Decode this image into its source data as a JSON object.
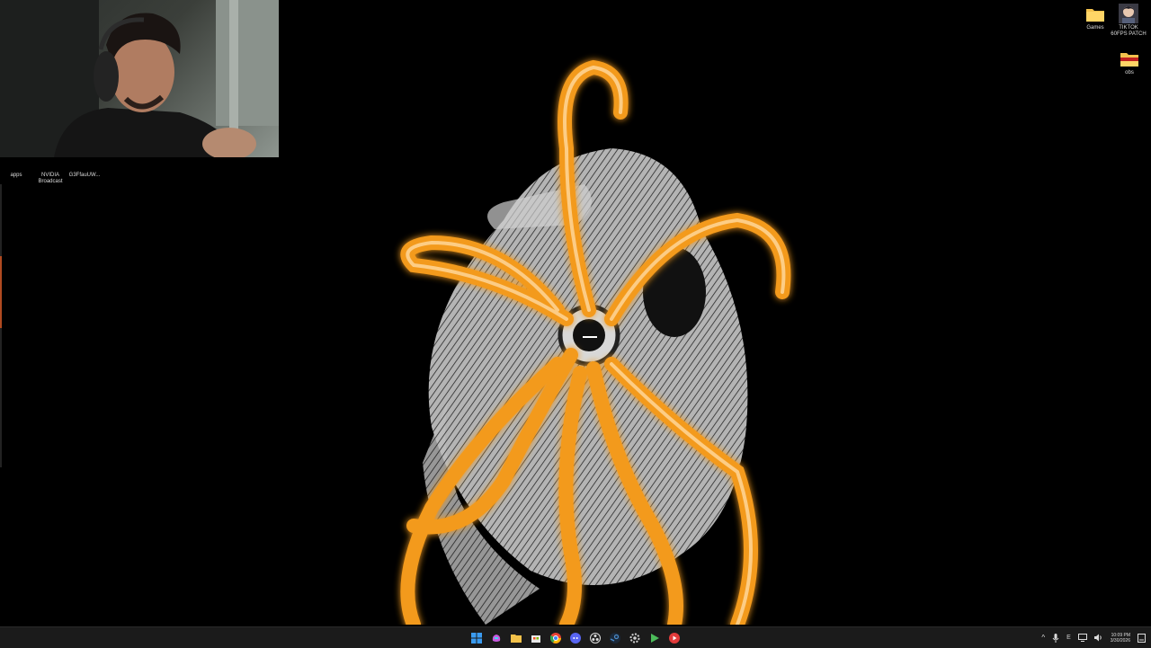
{
  "desktop": {
    "left_icons": [
      {
        "label": "apps",
        "icon": "app-shortcut-icon"
      },
      {
        "label": "NVIDIA\nBroadcast",
        "icon": "nvidia-broadcast-icon"
      },
      {
        "label": "G3FfauUW...",
        "icon": "file-shortcut-icon"
      }
    ],
    "right_icons": [
      {
        "label": "Games",
        "icon": "folder-icon"
      },
      {
        "label": "TIKTOK\n60FPS PATCH",
        "icon": "avatar-shortcut-icon"
      },
      {
        "label": "obs",
        "icon": "obs-folder-icon"
      }
    ]
  },
  "taskbar": {
    "apps": [
      {
        "name": "start",
        "icon": "windows-start-icon",
        "color": "#3a9bf0"
      },
      {
        "name": "copilot",
        "icon": "copilot-icon",
        "color": "#c95be0"
      },
      {
        "name": "file-explorer",
        "icon": "folder-icon",
        "color": "#f2c14a"
      },
      {
        "name": "store",
        "icon": "store-icon",
        "color": "#e8e8e8"
      },
      {
        "name": "chrome",
        "icon": "chrome-icon",
        "color": "#e94335"
      },
      {
        "name": "discord",
        "icon": "discord-icon",
        "color": "#5865f2"
      },
      {
        "name": "obs",
        "icon": "obs-icon",
        "color": "#dddddd"
      },
      {
        "name": "steam",
        "icon": "steam-icon",
        "color": "#4a8bc9"
      },
      {
        "name": "settings",
        "icon": "gear-icon",
        "color": "#cfcfcf"
      },
      {
        "name": "launcher",
        "icon": "play-icon",
        "color": "#4cbb5a"
      },
      {
        "name": "recorder",
        "icon": "record-icon",
        "color": "#e23b3b"
      }
    ],
    "tray": {
      "chevron": "^",
      "mic": "mic-icon",
      "lang": "E",
      "network": "network-icon",
      "volume": "volume-icon",
      "time": "10:09 PM",
      "date": "3/30/2026"
    }
  }
}
